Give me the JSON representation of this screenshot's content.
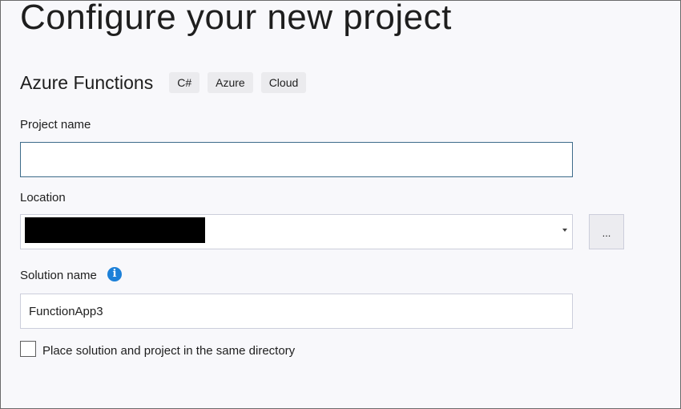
{
  "page": {
    "title": "Configure your new project"
  },
  "template": {
    "name": "Azure Functions",
    "tags": [
      "C#",
      "Azure",
      "Cloud"
    ]
  },
  "project_name": {
    "label": "Project name",
    "value": ""
  },
  "location": {
    "label": "Location",
    "value_redacted": true,
    "browse_label": "..."
  },
  "solution_name": {
    "label": "Solution name",
    "value": "FunctionApp3",
    "info_icon": "info-icon"
  },
  "same_directory": {
    "label": "Place solution and project in the same directory",
    "checked": false
  },
  "colors": {
    "accent": "#1c80d8",
    "focus_border": "#3d6b8a",
    "background": "#f8f8fb"
  }
}
